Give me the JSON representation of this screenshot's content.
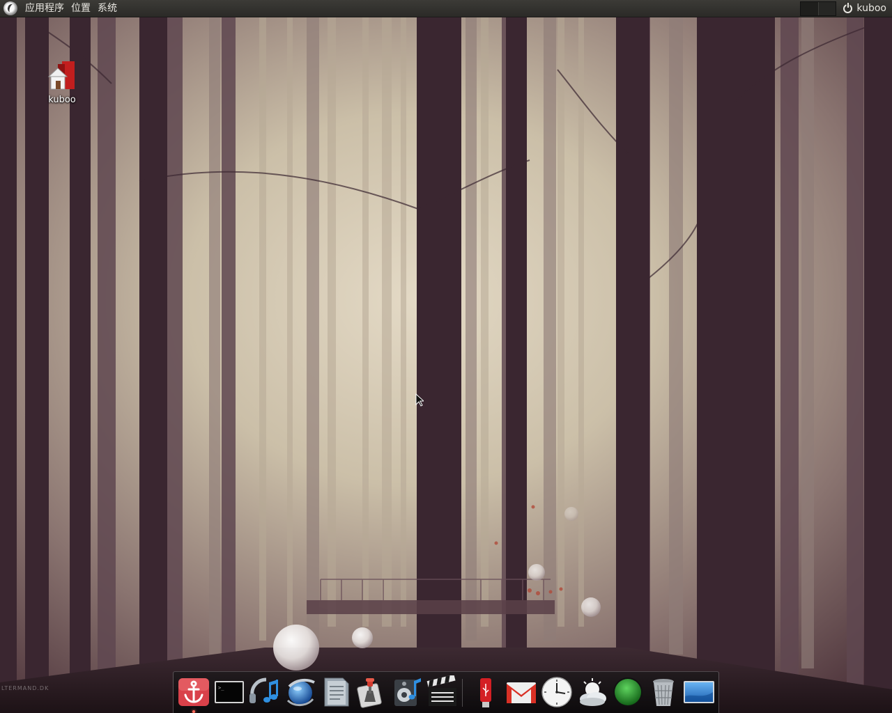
{
  "top_panel": {
    "menus": [
      {
        "label": "应用程序"
      },
      {
        "label": "位置"
      },
      {
        "label": "系统"
      }
    ],
    "user": "kuboo"
  },
  "desktop": {
    "icons": [
      {
        "label": "kuboo",
        "icon": "home-folder-icon"
      }
    ],
    "watermark": "LTERMAND.DK"
  },
  "dock": {
    "items": [
      {
        "name": "anchor",
        "icon": "anchor-icon"
      },
      {
        "name": "terminal",
        "icon": "terminal-icon"
      },
      {
        "name": "music-player",
        "icon": "music-note-icon"
      },
      {
        "name": "globe-browser",
        "icon": "globe-icon"
      },
      {
        "name": "text-editor",
        "icon": "document-icon"
      },
      {
        "name": "system-tools",
        "icon": "wrench-icon"
      },
      {
        "name": "audio-cd",
        "icon": "speaker-icon"
      },
      {
        "name": "video-player",
        "icon": "clapperboard-icon"
      },
      {
        "name": "usb-drive",
        "icon": "usb-drive-icon"
      },
      {
        "name": "gmail",
        "icon": "mail-icon"
      },
      {
        "name": "clock",
        "icon": "clock-icon"
      },
      {
        "name": "weather",
        "icon": "weather-icon"
      },
      {
        "name": "status-orb",
        "icon": "green-orb-icon"
      },
      {
        "name": "trash",
        "icon": "trash-icon"
      },
      {
        "name": "desktop-show",
        "icon": "show-desktop-icon"
      }
    ]
  },
  "colors": {
    "panel": "#3c3b37",
    "dock_background": "#1a1618",
    "wallpaper_fog": "#d9cfbd",
    "wallpaper_trunks": "#3a2630"
  }
}
